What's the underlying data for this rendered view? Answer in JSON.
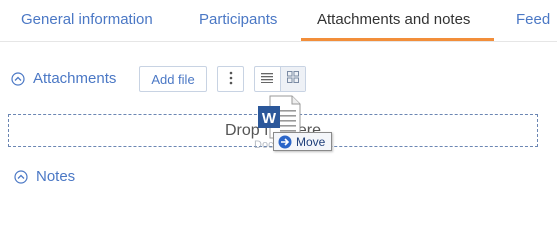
{
  "tabs": [
    {
      "label": "General information",
      "active": false
    },
    {
      "label": "Participants",
      "active": false
    },
    {
      "label": "Attachments and notes",
      "active": true
    },
    {
      "label": "Feed",
      "active": false
    }
  ],
  "attachments": {
    "title": "Attachments",
    "add_file_label": "Add file",
    "more_icon": "more-vertical-icon",
    "list_view_icon": "list-view-icon",
    "tile_view_icon": "tile-view-icon",
    "drop_text": "Drop file here"
  },
  "drag": {
    "file_label": "Document",
    "tooltip": "Move",
    "file_icon": "word-document-icon"
  },
  "notes": {
    "title": "Notes"
  },
  "colors": {
    "accent": "#4b78c5",
    "active_tab_underline": "#f28e3a",
    "word_blue": "#2b579a"
  }
}
